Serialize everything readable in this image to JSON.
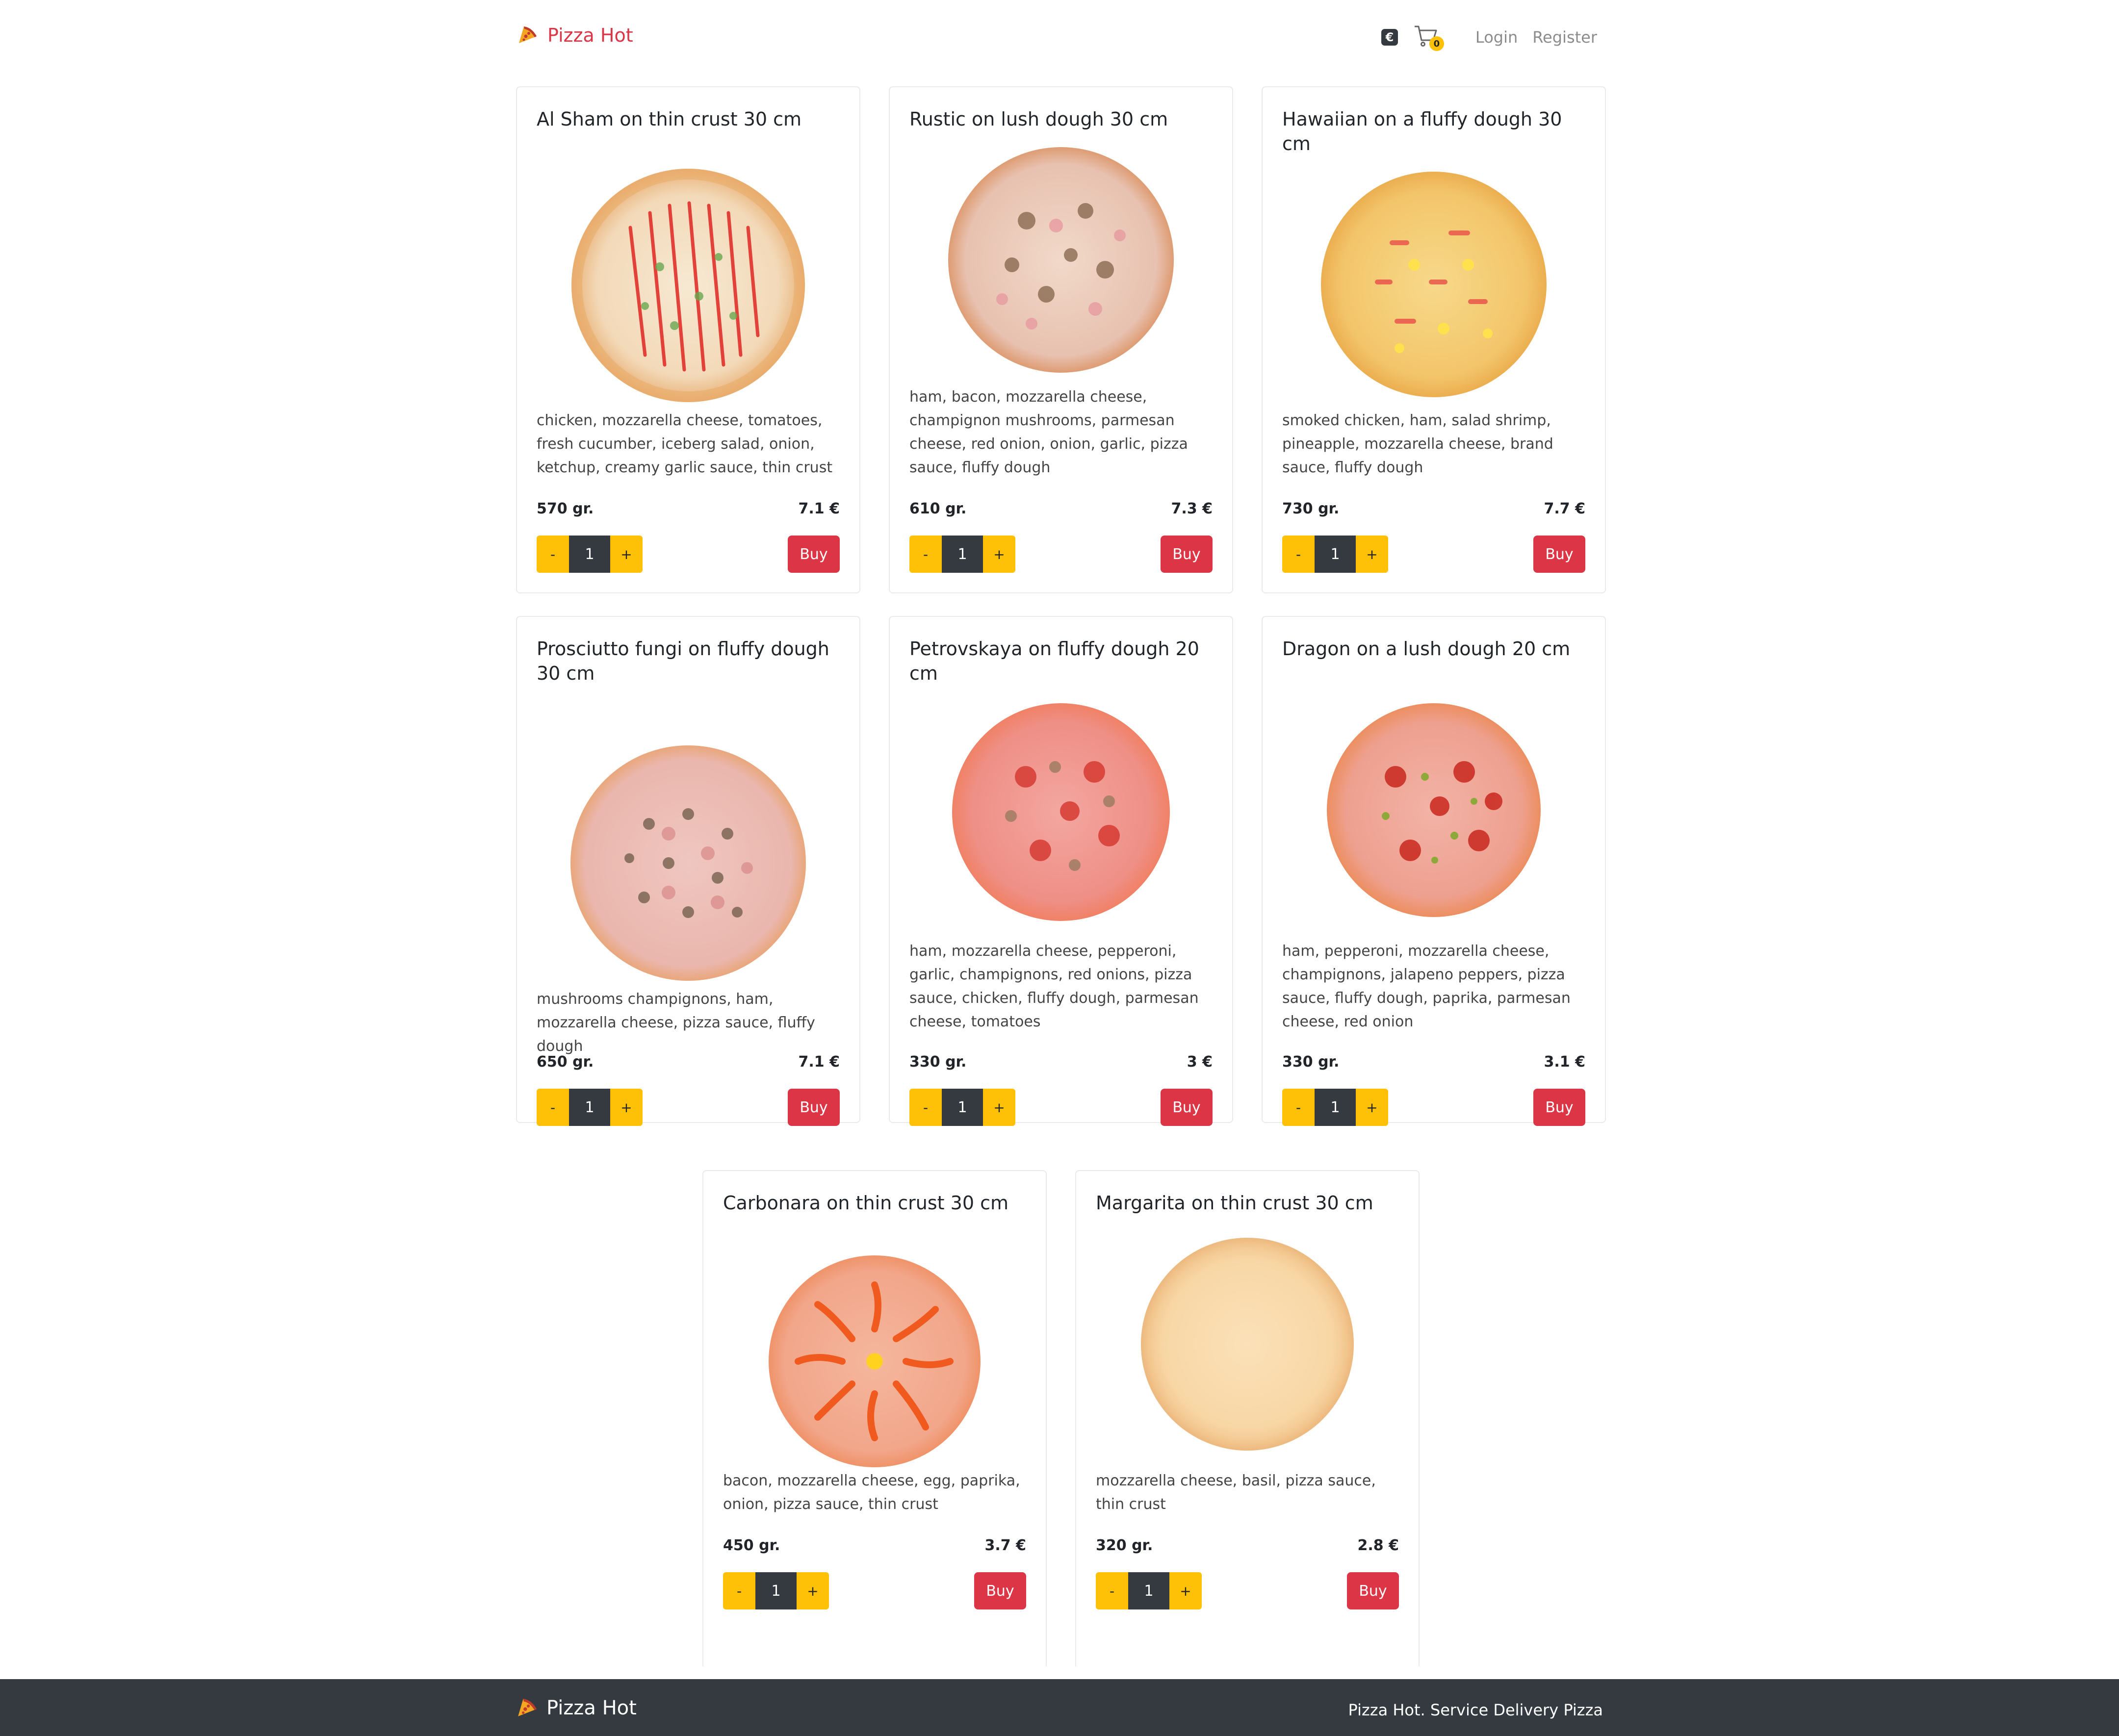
{
  "header": {
    "brand": "Pizza Hot",
    "currency_badge": "€",
    "cart_count": "0",
    "login": "Login",
    "register": "Register"
  },
  "pizzas": [
    {
      "title": "Al Sham on thin crust 30 cm",
      "description": "chicken, mozzarella cheese, tomatoes, fresh cucumber, iceberg salad, onion, ketchup, creamy garlic sauce, thin crust",
      "weight": "570 gr.",
      "price": "7.1 €",
      "quantity": "1",
      "minus": "-",
      "plus": "+",
      "buy": "Buy"
    },
    {
      "title": "Rustic on lush dough 30 cm",
      "description": "ham, bacon, mozzarella cheese, champignon mushrooms, parmesan cheese, red onion, onion, garlic, pizza sauce, fluffy dough",
      "weight": "610 gr.",
      "price": "7.3 €",
      "quantity": "1",
      "minus": "-",
      "plus": "+",
      "buy": "Buy"
    },
    {
      "title": "Hawaiian on a fluffy dough 30 cm",
      "description": "smoked chicken, ham, salad shrimp, pineapple, mozzarella cheese, brand sauce, fluffy dough",
      "weight": "730 gr.",
      "price": "7.7 €",
      "quantity": "1",
      "minus": "-",
      "plus": "+",
      "buy": "Buy"
    },
    {
      "title": "Prosciutto fungi on fluffy dough 30 cm",
      "description": "mushrooms champignons, ham, mozzarella cheese, pizza sauce, fluffy dough",
      "weight": "650 gr.",
      "price": "7.1 €",
      "quantity": "1",
      "minus": "-",
      "plus": "+",
      "buy": "Buy"
    },
    {
      "title": "Petrovskaya on fluffy dough 20 cm",
      "description": "ham, mozzarella cheese, pepperoni, garlic, champignons, red onions, pizza sauce, chicken, fluffy dough, parmesan cheese, tomatoes",
      "weight": "330 gr.",
      "price": "3 €",
      "quantity": "1",
      "minus": "-",
      "plus": "+",
      "buy": "Buy"
    },
    {
      "title": "Dragon on a lush dough 20 cm",
      "description": "ham, pepperoni, mozzarella cheese, champignons, jalapeno peppers, pizza sauce, fluffy dough, paprika, parmesan cheese, red onion",
      "weight": "330 gr.",
      "price": "3.1 €",
      "quantity": "1",
      "minus": "-",
      "plus": "+",
      "buy": "Buy"
    },
    {
      "title": "Carbonara on thin crust 30 cm",
      "description": "bacon, mozzarella cheese, egg, paprika, onion, pizza sauce, thin crust",
      "weight": "450 gr.",
      "price": "3.7 €",
      "quantity": "1",
      "minus": "-",
      "plus": "+",
      "buy": "Buy"
    },
    {
      "title": "Margarita on thin crust 30 cm",
      "description": "mozzarella cheese, basil, pizza sauce, thin crust",
      "weight": "320 gr.",
      "price": "2.8 €",
      "quantity": "1",
      "minus": "-",
      "plus": "+",
      "buy": "Buy"
    }
  ],
  "footer": {
    "brand": "Pizza Hot",
    "tagline": "Pizza Hot. Service Delivery Pizza"
  },
  "colors": {
    "brand_red": "#dc3545",
    "qty_yellow": "#ffc107",
    "dark": "#343a40"
  }
}
